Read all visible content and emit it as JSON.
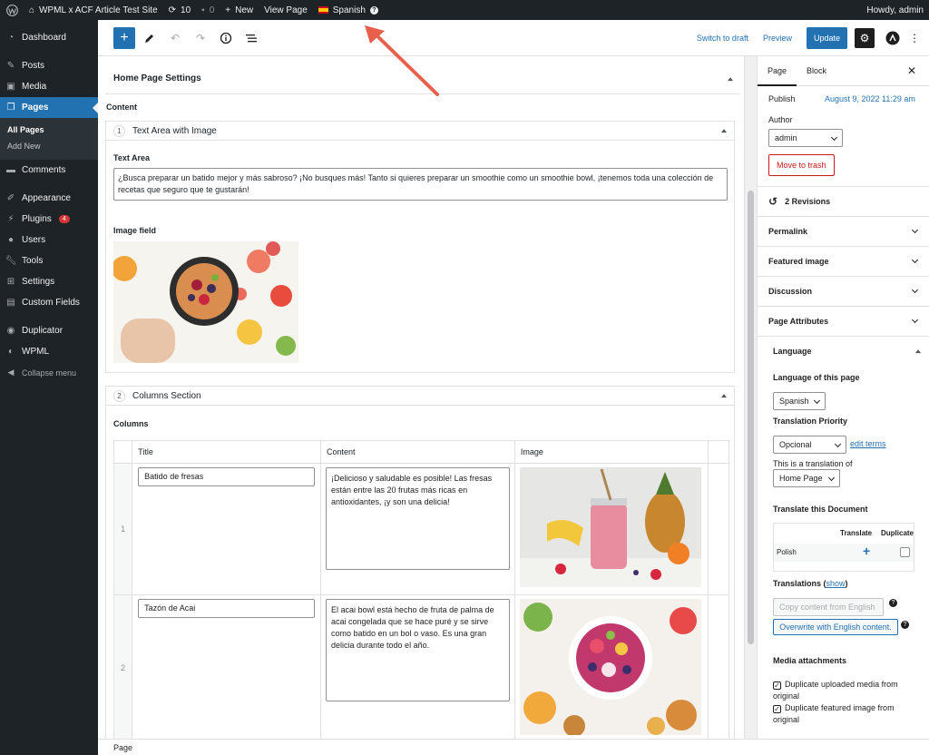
{
  "adminbar": {
    "site_name": "WPML x ACF Article Test Site",
    "updates_count": "10",
    "comments_count": "0",
    "new_label": "New",
    "view_page": "View Page",
    "language": "Spanish",
    "howdy": "Howdy, admin"
  },
  "sidebar": {
    "items": [
      {
        "label": "Dashboard",
        "icon": "dashboard-icon"
      },
      {
        "label": "Posts",
        "icon": "pin-icon"
      },
      {
        "label": "Media",
        "icon": "media-icon"
      },
      {
        "label": "Pages",
        "icon": "pages-icon"
      },
      {
        "label": "Comments",
        "icon": "comment-icon"
      },
      {
        "label": "Appearance",
        "icon": "brush-icon"
      },
      {
        "label": "Plugins",
        "icon": "plugin-icon",
        "badge": "4"
      },
      {
        "label": "Users",
        "icon": "user-icon"
      },
      {
        "label": "Tools",
        "icon": "wrench-icon"
      },
      {
        "label": "Settings",
        "icon": "settings-icon"
      },
      {
        "label": "Custom Fields",
        "icon": "fields-icon"
      },
      {
        "label": "Duplicator",
        "icon": "duplicator-icon"
      },
      {
        "label": "WPML",
        "icon": "wpml-icon"
      },
      {
        "label": "Collapse menu",
        "icon": "collapse-icon"
      }
    ],
    "submenu": [
      "All Pages",
      "Add New"
    ]
  },
  "toolbar": {
    "switch_to_draft": "Switch to draft",
    "preview": "Preview",
    "update": "Update"
  },
  "editor": {
    "panel_title": "Home Page Settings",
    "content_label": "Content",
    "layout1": {
      "num": "1",
      "title": "Text Area with Image",
      "text_area_label": "Text Area",
      "text_area_value": "¿Busca preparar un batido mejor y más sabroso? ¡No busques más! Tanto si quieres preparar un smoothie como un smoothie bowl, ¡tenemos toda una colección de recetas que seguro que te gustarán!",
      "image_label": "Image field"
    },
    "layout2": {
      "num": "2",
      "title": "Columns Section",
      "columns_label": "Columns",
      "headers": [
        "Title",
        "Content",
        "Image"
      ],
      "rows": [
        {
          "num": "1",
          "title": "Batido de fresas",
          "content": "¡Delicioso y saludable es posible! Las fresas están entre las 20 frutas más ricas en antioxidantes, ¡y son una delicia!"
        },
        {
          "num": "2",
          "title": "Tazón de Acai",
          "content": "El acai bowl está hecho de fruta de palma de acai congelada que se hace puré y se sirve como batido en un bol o vaso. Es una gran delicia durante todo el año."
        }
      ]
    }
  },
  "statusbar": {
    "text": "Page"
  },
  "settings": {
    "tabs": [
      "Page",
      "Block"
    ],
    "publish_label": "Publish",
    "publish_value": "August 9, 2022 11:29 am",
    "author_label": "Author",
    "author_value": "admin",
    "trash": "Move to trash",
    "revisions": "2 Revisions",
    "sections": [
      "Permalink",
      "Featured image",
      "Discussion",
      "Page Attributes"
    ],
    "language": {
      "title": "Language",
      "lang_of_page": "Language of this page",
      "lang_value": "Spanish",
      "priority_label": "Translation Priority",
      "priority_value": "Opcional",
      "edit_terms": "edit terms",
      "translation_of": "This is a translation of",
      "translation_of_value": "Home Page",
      "translate_doc": "Translate this Document",
      "col_translate": "Translate",
      "col_duplicate": "Duplicate",
      "row_lang": "Polish",
      "translations": "Translations",
      "show": "show",
      "copy_content": "Copy content from English",
      "overwrite": "Overwrite with English content.",
      "media_title": "Media attachments",
      "dup_media": "Duplicate uploaded media from original",
      "dup_featured": "Duplicate featured image from original"
    }
  },
  "colors": {
    "accent": "#2271b1",
    "adminbar": "#1d2327",
    "annotation_arrow": "#e8604c"
  }
}
